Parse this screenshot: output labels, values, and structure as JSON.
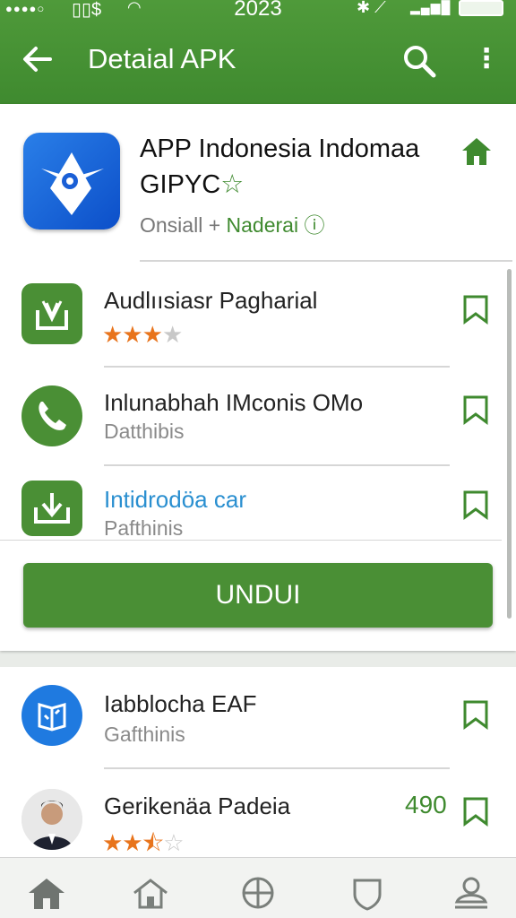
{
  "status_bar": {
    "time": "2023"
  },
  "app_bar": {
    "title": "Detaial APK"
  },
  "app": {
    "title": "APP Indonesia Indomaa GIPYC",
    "meta_prefix": "Onsiall +",
    "developer": "Naderai"
  },
  "related": [
    {
      "title": "Audlıısiasr Pagharial",
      "stars": 3
    },
    {
      "title": "Inlunabhah IMconis OMo",
      "subtitle": "Datthibis"
    },
    {
      "title": "Intidrodöa car",
      "subtitle": "Pafthinis"
    }
  ],
  "download_button": {
    "label": "UNDUI"
  },
  "more": [
    {
      "title": "Iabblocha EAF",
      "subtitle": "Gafthinis"
    },
    {
      "title": "Gerikenäa Padeia",
      "count": "490",
      "stars": 2.5
    }
  ],
  "colors": {
    "primary_green": "#4a8f35",
    "accent_orange": "#e8741c",
    "link_blue": "#2a8fd0"
  },
  "icons": {
    "nav": [
      "home-icon",
      "house-icon",
      "globe-icon",
      "shield-icon",
      "user-icon"
    ]
  }
}
